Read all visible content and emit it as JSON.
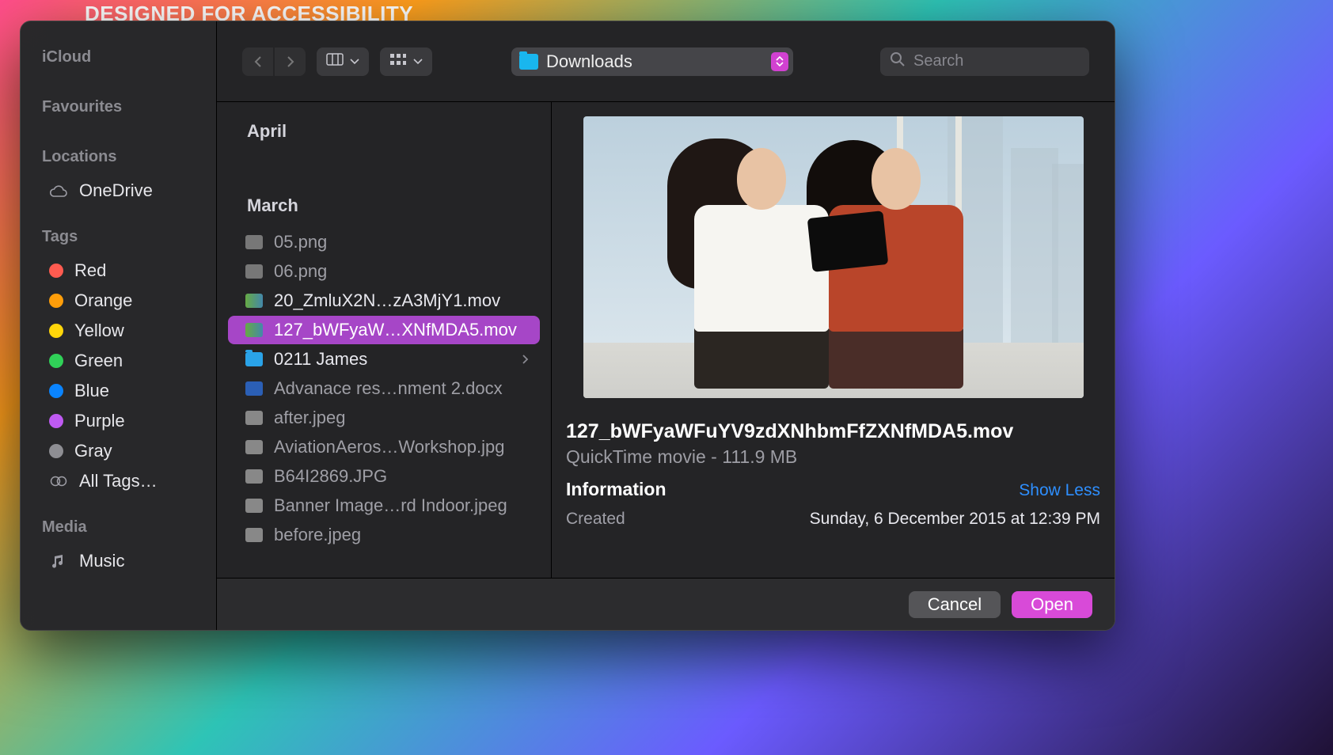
{
  "backdrop_text": "DESIGNED FOR ACCESSIBILITY",
  "sidebar": {
    "icloud": "iCloud",
    "favourites": "Favourites",
    "locations": "Locations",
    "onedrive": "OneDrive",
    "tags_label": "Tags",
    "tags": [
      {
        "label": "Red",
        "color": "#ff5b50"
      },
      {
        "label": "Orange",
        "color": "#ff9e0a"
      },
      {
        "label": "Yellow",
        "color": "#ffd60a"
      },
      {
        "label": "Green",
        "color": "#30d158"
      },
      {
        "label": "Blue",
        "color": "#0a84ff"
      },
      {
        "label": "Purple",
        "color": "#bf5af2"
      },
      {
        "label": "Gray",
        "color": "#8e8e93"
      }
    ],
    "all_tags": "All Tags…",
    "media": "Media",
    "music": "Music"
  },
  "toolbar": {
    "location": "Downloads",
    "search_placeholder": "Search"
  },
  "list": {
    "group1": "April",
    "group2": "March",
    "files": [
      {
        "name": "05.png",
        "kind": "png",
        "enabled": false
      },
      {
        "name": "06.png",
        "kind": "png",
        "enabled": false
      },
      {
        "name": "20_ZmluX2N…zA3MjY1.mov",
        "kind": "mov",
        "enabled": true
      },
      {
        "name": "127_bWFyaW…XNfMDA5.mov",
        "kind": "mov",
        "enabled": true,
        "selected": true
      },
      {
        "name": "0211 James",
        "kind": "folder",
        "enabled": true,
        "arrow": true
      },
      {
        "name": "Advanace res…nment 2.docx",
        "kind": "docx",
        "enabled": false
      },
      {
        "name": "after.jpeg",
        "kind": "jpg",
        "enabled": false
      },
      {
        "name": "AviationAeros…Workshop.jpg",
        "kind": "jpg",
        "enabled": false
      },
      {
        "name": "B64I2869.JPG",
        "kind": "jpg",
        "enabled": false
      },
      {
        "name": "Banner Image…rd Indoor.jpeg",
        "kind": "jpg",
        "enabled": false
      },
      {
        "name": "before.jpeg",
        "kind": "jpg",
        "enabled": false
      }
    ]
  },
  "preview": {
    "title": "127_bWFyaWFuYV9zdXNhbmFfZXNfMDA5.mov",
    "kind": "QuickTime movie - 111.9 MB",
    "info": "Information",
    "show_less": "Show Less",
    "created_k": "Created",
    "created_v": "Sunday, 6 December 2015 at 12:39 PM"
  },
  "footer": {
    "cancel": "Cancel",
    "open": "Open"
  }
}
